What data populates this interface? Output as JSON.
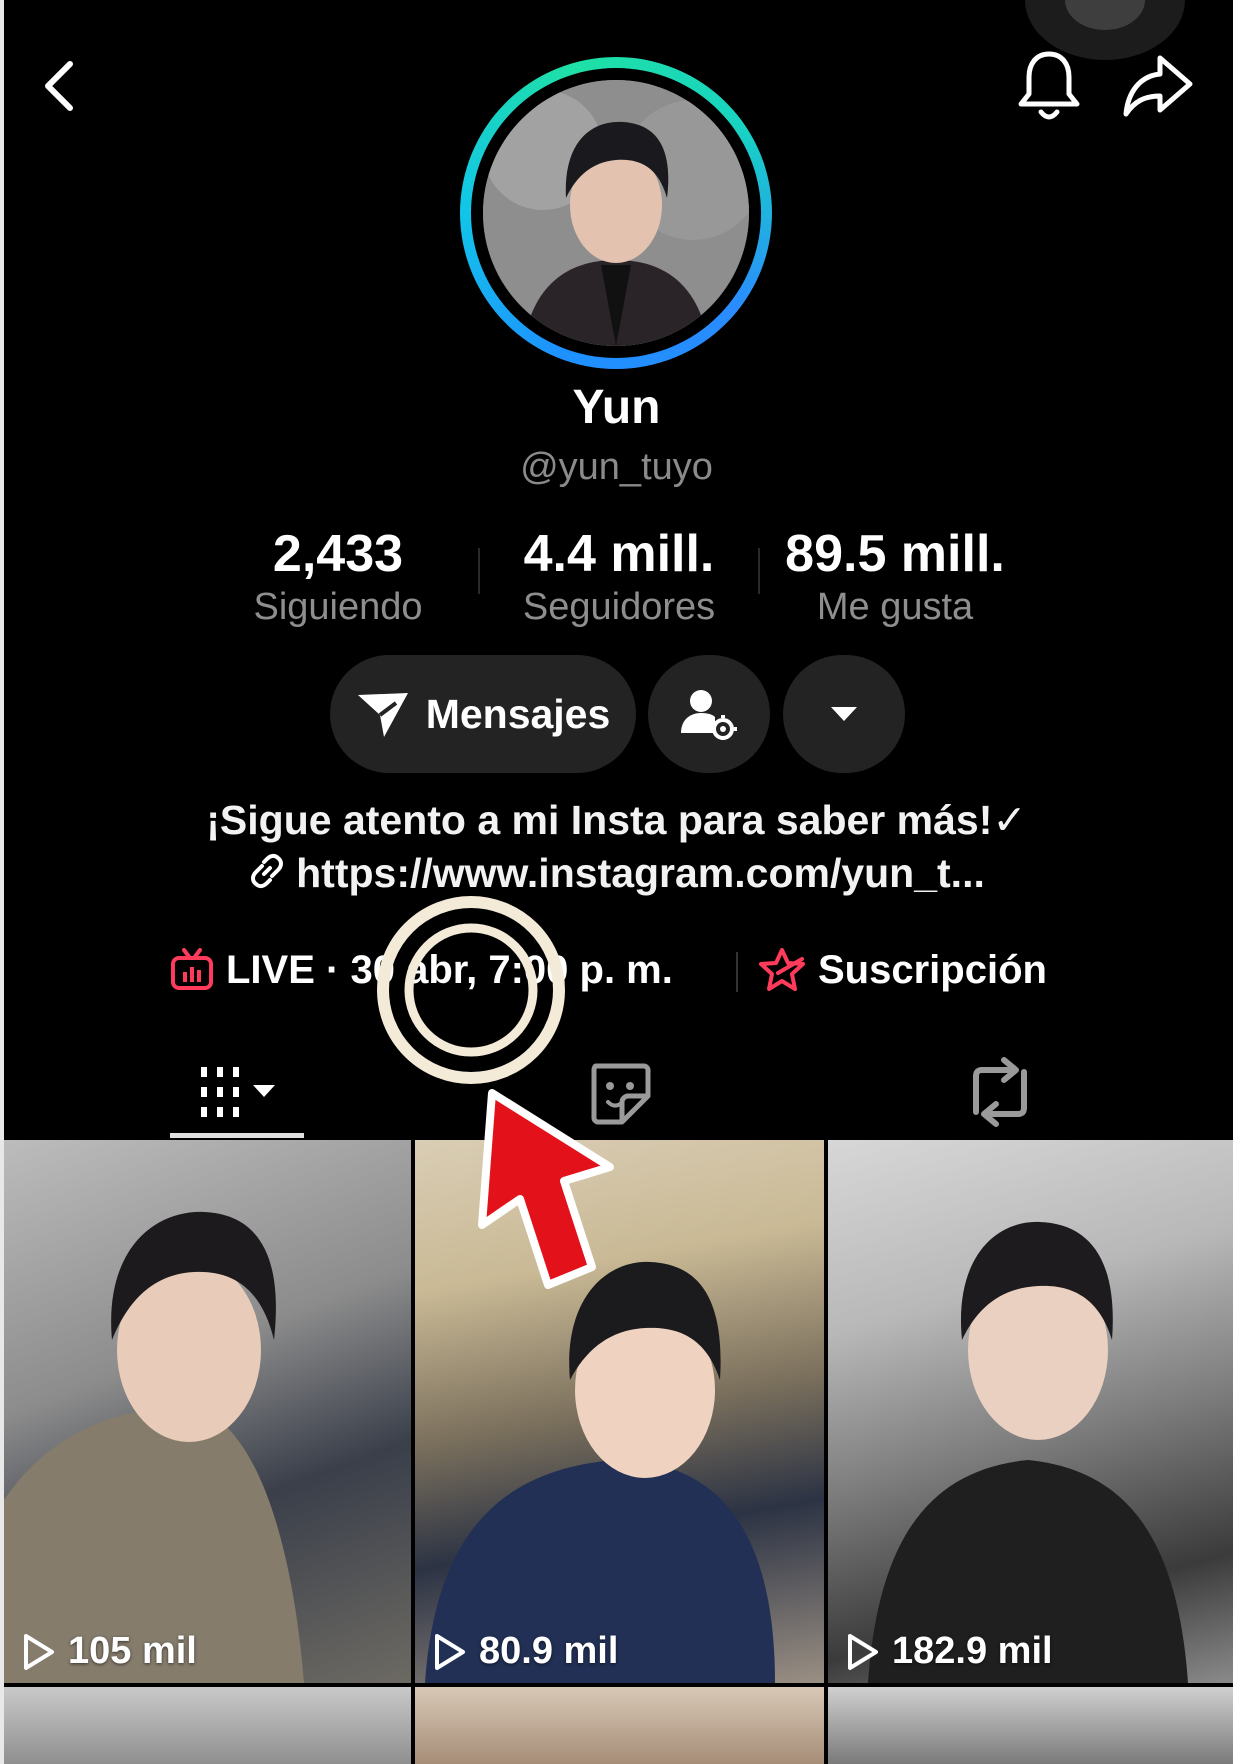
{
  "header": {
    "back_icon": "chevron-left-icon",
    "bell_icon": "bell-icon",
    "share_icon": "share-arrow-icon"
  },
  "profile": {
    "name": "Yun",
    "handle": "@yun_tuyo",
    "ring_colors": [
      "#1e90ff",
      "#1fe0a5"
    ]
  },
  "stats": [
    {
      "value": "2,433",
      "label": "Siguiendo"
    },
    {
      "value": "4.4 mill.",
      "label": "Seguidores"
    },
    {
      "value": "89.5 mill.",
      "label": "Me gusta"
    }
  ],
  "actions": {
    "message_label": "Mensajes",
    "message_icon": "paper-plane-icon",
    "follow_settings_icon": "user-gear-icon",
    "more_icon": "caret-down-icon"
  },
  "bio": {
    "text": "¡Sigue atento a mi Insta para saber más!✓",
    "link": "https://www.instagram.com/yun_t..."
  },
  "live": {
    "label": "LIVE",
    "schedule": "· 30 abr, 7:00 p. m.",
    "accent": "#ff3b5c"
  },
  "subscription": {
    "label": "Suscripción"
  },
  "tabs": [
    {
      "name": "videos",
      "icon": "video-grid-icon",
      "active": true
    },
    {
      "name": "stickers",
      "icon": "sticker-icon",
      "active": false
    },
    {
      "name": "reposts",
      "icon": "repost-icon",
      "active": false
    }
  ],
  "videos": [
    {
      "views": "105 mil"
    },
    {
      "views": "80.9 mil"
    },
    {
      "views": "182.9 mil"
    }
  ]
}
